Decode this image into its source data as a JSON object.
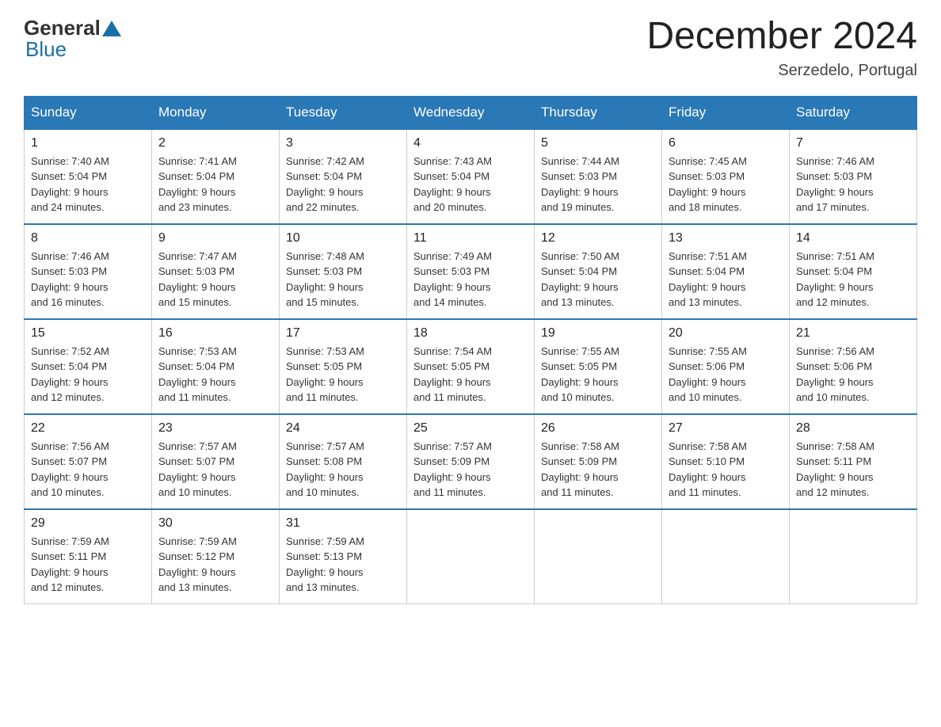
{
  "header": {
    "logo_general": "General",
    "logo_blue": "Blue",
    "month_title": "December 2024",
    "location": "Serzedelo, Portugal"
  },
  "days_of_week": [
    "Sunday",
    "Monday",
    "Tuesday",
    "Wednesday",
    "Thursday",
    "Friday",
    "Saturday"
  ],
  "weeks": [
    [
      {
        "day": "1",
        "sunrise": "7:40 AM",
        "sunset": "5:04 PM",
        "daylight": "9 hours and 24 minutes."
      },
      {
        "day": "2",
        "sunrise": "7:41 AM",
        "sunset": "5:04 PM",
        "daylight": "9 hours and 23 minutes."
      },
      {
        "day": "3",
        "sunrise": "7:42 AM",
        "sunset": "5:04 PM",
        "daylight": "9 hours and 22 minutes."
      },
      {
        "day": "4",
        "sunrise": "7:43 AM",
        "sunset": "5:04 PM",
        "daylight": "9 hours and 20 minutes."
      },
      {
        "day": "5",
        "sunrise": "7:44 AM",
        "sunset": "5:03 PM",
        "daylight": "9 hours and 19 minutes."
      },
      {
        "day": "6",
        "sunrise": "7:45 AM",
        "sunset": "5:03 PM",
        "daylight": "9 hours and 18 minutes."
      },
      {
        "day": "7",
        "sunrise": "7:46 AM",
        "sunset": "5:03 PM",
        "daylight": "9 hours and 17 minutes."
      }
    ],
    [
      {
        "day": "8",
        "sunrise": "7:46 AM",
        "sunset": "5:03 PM",
        "daylight": "9 hours and 16 minutes."
      },
      {
        "day": "9",
        "sunrise": "7:47 AM",
        "sunset": "5:03 PM",
        "daylight": "9 hours and 15 minutes."
      },
      {
        "day": "10",
        "sunrise": "7:48 AM",
        "sunset": "5:03 PM",
        "daylight": "9 hours and 15 minutes."
      },
      {
        "day": "11",
        "sunrise": "7:49 AM",
        "sunset": "5:03 PM",
        "daylight": "9 hours and 14 minutes."
      },
      {
        "day": "12",
        "sunrise": "7:50 AM",
        "sunset": "5:04 PM",
        "daylight": "9 hours and 13 minutes."
      },
      {
        "day": "13",
        "sunrise": "7:51 AM",
        "sunset": "5:04 PM",
        "daylight": "9 hours and 13 minutes."
      },
      {
        "day": "14",
        "sunrise": "7:51 AM",
        "sunset": "5:04 PM",
        "daylight": "9 hours and 12 minutes."
      }
    ],
    [
      {
        "day": "15",
        "sunrise": "7:52 AM",
        "sunset": "5:04 PM",
        "daylight": "9 hours and 12 minutes."
      },
      {
        "day": "16",
        "sunrise": "7:53 AM",
        "sunset": "5:04 PM",
        "daylight": "9 hours and 11 minutes."
      },
      {
        "day": "17",
        "sunrise": "7:53 AM",
        "sunset": "5:05 PM",
        "daylight": "9 hours and 11 minutes."
      },
      {
        "day": "18",
        "sunrise": "7:54 AM",
        "sunset": "5:05 PM",
        "daylight": "9 hours and 11 minutes."
      },
      {
        "day": "19",
        "sunrise": "7:55 AM",
        "sunset": "5:05 PM",
        "daylight": "9 hours and 10 minutes."
      },
      {
        "day": "20",
        "sunrise": "7:55 AM",
        "sunset": "5:06 PM",
        "daylight": "9 hours and 10 minutes."
      },
      {
        "day": "21",
        "sunrise": "7:56 AM",
        "sunset": "5:06 PM",
        "daylight": "9 hours and 10 minutes."
      }
    ],
    [
      {
        "day": "22",
        "sunrise": "7:56 AM",
        "sunset": "5:07 PM",
        "daylight": "9 hours and 10 minutes."
      },
      {
        "day": "23",
        "sunrise": "7:57 AM",
        "sunset": "5:07 PM",
        "daylight": "9 hours and 10 minutes."
      },
      {
        "day": "24",
        "sunrise": "7:57 AM",
        "sunset": "5:08 PM",
        "daylight": "9 hours and 10 minutes."
      },
      {
        "day": "25",
        "sunrise": "7:57 AM",
        "sunset": "5:09 PM",
        "daylight": "9 hours and 11 minutes."
      },
      {
        "day": "26",
        "sunrise": "7:58 AM",
        "sunset": "5:09 PM",
        "daylight": "9 hours and 11 minutes."
      },
      {
        "day": "27",
        "sunrise": "7:58 AM",
        "sunset": "5:10 PM",
        "daylight": "9 hours and 11 minutes."
      },
      {
        "day": "28",
        "sunrise": "7:58 AM",
        "sunset": "5:11 PM",
        "daylight": "9 hours and 12 minutes."
      }
    ],
    [
      {
        "day": "29",
        "sunrise": "7:59 AM",
        "sunset": "5:11 PM",
        "daylight": "9 hours and 12 minutes."
      },
      {
        "day": "30",
        "sunrise": "7:59 AM",
        "sunset": "5:12 PM",
        "daylight": "9 hours and 13 minutes."
      },
      {
        "day": "31",
        "sunrise": "7:59 AM",
        "sunset": "5:13 PM",
        "daylight": "9 hours and 13 minutes."
      },
      null,
      null,
      null,
      null
    ]
  ],
  "labels": {
    "sunrise": "Sunrise:",
    "sunset": "Sunset:",
    "daylight": "Daylight:"
  }
}
